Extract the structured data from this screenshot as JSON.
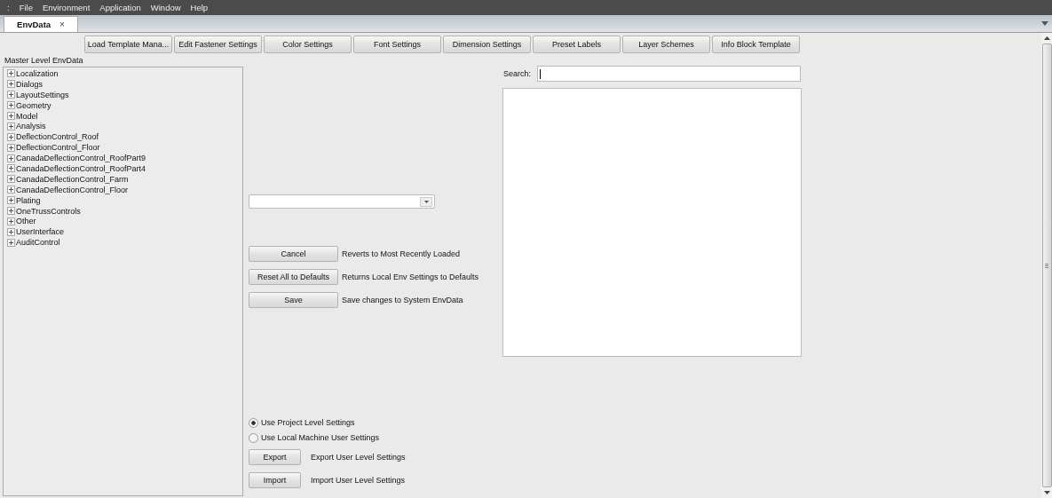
{
  "menu": [
    ":",
    "File",
    "Environment",
    "Application",
    "Window",
    "Help"
  ],
  "tabs": [
    {
      "label": "EnvData",
      "close": "×",
      "selected": true
    }
  ],
  "toolbar": [
    "Load Template Mana...",
    "Edit Fastener Settings",
    "Color Settings",
    "Font Settings",
    "Dimension Settings",
    "Preset Labels",
    "Layer Schemes",
    "Info Block Template"
  ],
  "tree": {
    "title": "Master Level EnvData",
    "items": [
      {
        "label": "Localization",
        "expanded": false
      },
      {
        "label": "Dialogs",
        "expanded": false
      },
      {
        "label": "LayoutSettings",
        "expanded": false
      },
      {
        "label": "Geometry",
        "expanded": false
      },
      {
        "label": "Model",
        "expanded": false
      },
      {
        "label": "Analysis",
        "expanded": false
      },
      {
        "label": "DeflectionControl_Roof",
        "expanded": false
      },
      {
        "label": "DeflectionControl_Floor",
        "expanded": false
      },
      {
        "label": "CanadaDeflectionControl_RoofPart9",
        "expanded": false
      },
      {
        "label": "CanadaDeflectionControl_RoofPart4",
        "expanded": false
      },
      {
        "label": "CanadaDeflectionControl_Farm",
        "expanded": false
      },
      {
        "label": "CanadaDeflectionControl_Floor",
        "expanded": false
      },
      {
        "label": "Plating",
        "expanded": false
      },
      {
        "label": "OneTrussControls",
        "expanded": false
      },
      {
        "label": "Other",
        "expanded": false
      },
      {
        "label": "UserInterface",
        "expanded": false
      },
      {
        "label": "AuditControl",
        "expanded": false
      }
    ]
  },
  "actions": [
    {
      "button": "Cancel",
      "description": "Reverts to Most Recently Loaded"
    },
    {
      "button": "Reset All to Defaults",
      "description": "Returns Local Env Settings to Defaults"
    },
    {
      "button": "Save",
      "description": "Save changes to System EnvData"
    }
  ],
  "levels": [
    {
      "label": "Use Project Level Settings",
      "selected": true
    },
    {
      "label": "Use Local Machine User Settings",
      "selected": false
    }
  ],
  "transfer": [
    {
      "button": "Export",
      "description": "Export User Level Settings"
    },
    {
      "button": "Import",
      "description": "Import User Level Settings"
    }
  ],
  "search": {
    "label": "Search:"
  }
}
